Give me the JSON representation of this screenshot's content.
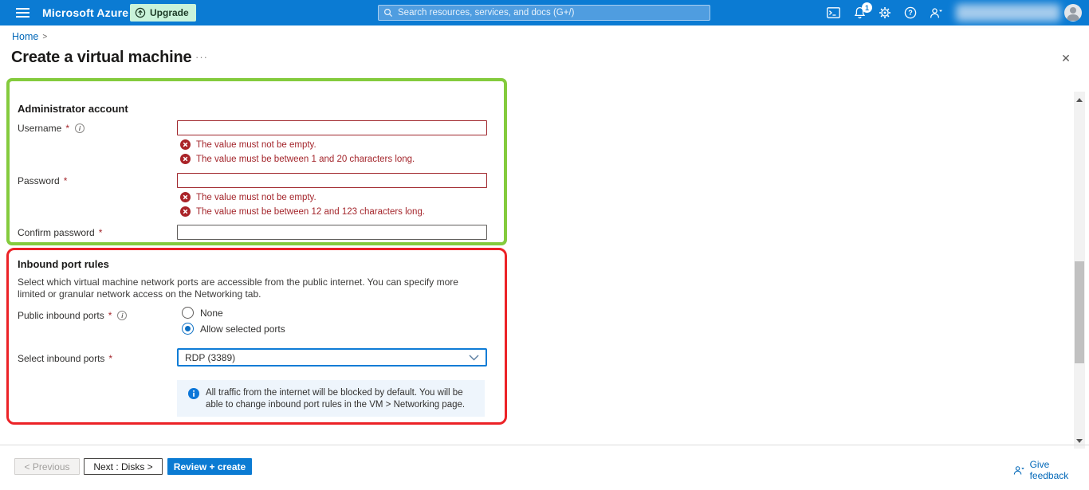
{
  "topbar": {
    "brand": "Microsoft Azure",
    "upgrade_label": "Upgrade",
    "search_placeholder": "Search resources, services, and docs (G+/)",
    "notification_count": "1",
    "colors": {
      "bar": "#0b7bd3",
      "upgrade_bg": "#c9f3da"
    }
  },
  "breadcrumb": {
    "home": "Home",
    "separator": ">"
  },
  "page": {
    "title": "Create a virtual machine",
    "more": "···",
    "close": "✕"
  },
  "form": {
    "admin_section": {
      "heading": "Administrator account",
      "username": {
        "label": "Username",
        "required": "*",
        "value": "",
        "errors": [
          "The value must not be empty.",
          "The value must be between 1 and 20 characters long."
        ]
      },
      "password": {
        "label": "Password",
        "required": "*",
        "value": "",
        "errors": [
          "The value must not be empty.",
          "The value must be between 12 and 123 characters long."
        ]
      },
      "confirm_password": {
        "label": "Confirm password",
        "required": "*",
        "value": ""
      }
    },
    "inbound_section": {
      "heading": "Inbound port rules",
      "description": "Select which virtual machine network ports are accessible from the public internet. You can specify more limited or granular network access on the Networking tab.",
      "public_inbound_ports": {
        "label": "Public inbound ports",
        "required": "*",
        "options": [
          {
            "label": "None",
            "selected": false
          },
          {
            "label": "Allow selected ports",
            "selected": true
          }
        ]
      },
      "select_inbound_ports": {
        "label": "Select inbound ports",
        "required": "*",
        "value": "RDP (3389)"
      },
      "info_note": "All traffic from the internet will be blocked by default. You will be able to change inbound port rules in the VM > Networking page."
    }
  },
  "footer": {
    "previous_label": "< Previous",
    "next_label": "Next : Disks >",
    "review_create_label": "Review + create",
    "feedback_label": "Give feedback"
  },
  "annotations": {
    "green_box": "#84cb3d",
    "red_box": "#ec2227"
  }
}
